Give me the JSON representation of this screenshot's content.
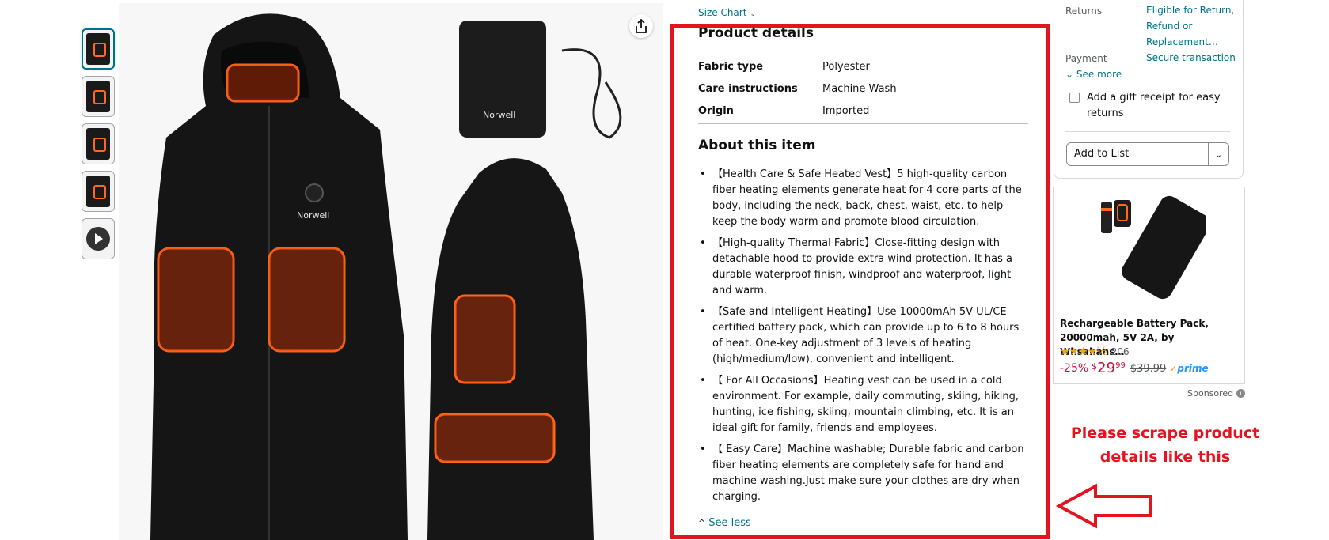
{
  "thumbnails": [
    {
      "name": "thumbnail-1",
      "active": true
    },
    {
      "name": "thumbnail-2",
      "active": false
    },
    {
      "name": "thumbnail-3",
      "active": false
    },
    {
      "name": "thumbnail-4",
      "active": false
    },
    {
      "name": "thumbnail-video",
      "active": false
    }
  ],
  "product_image": {
    "brand_on_vest": "Norwell",
    "brand_on_battery": "Norwell"
  },
  "size_chart": {
    "label": "Size Chart"
  },
  "product_details": {
    "title": "Product details",
    "rows": [
      {
        "key": "Fabric type",
        "value": "Polyester"
      },
      {
        "key": "Care instructions",
        "value": "Machine Wash"
      },
      {
        "key": "Origin",
        "value": "Imported"
      }
    ]
  },
  "about": {
    "title": "About this item",
    "bullets": [
      "【Health Care & Safe Heated Vest】5 high-quality carbon fiber heating elements generate heat for 4 core parts of the body, including the neck, back, chest, waist, etc. to help keep the body warm and promote blood circulation.",
      "【High-quality Thermal Fabric】Close-fitting design with detachable hood to provide extra wind protection. It has a durable waterproof finish, windproof and waterproof, light and warm.",
      "【Safe and Intelligent Heating】Use 10000mAh 5V UL/CE certified battery pack, which can provide up to 6 to 8 hours of heat. One-key adjustment of 3 levels of heating (high/medium/low), convenient and intelligent.",
      "【 For All Occasions】Heating vest can be used in a cold environment. For example, daily commuting, skiing, hiking, hunting, ice fishing, skiing, mountain climbing, etc. It is an ideal gift for family, friends and employees.",
      "【 Easy Care】Machine washable; Durable fabric and carbon fiber heating elements are completely safe for hand and machine washing.Just make sure your clothes are dry when charging."
    ],
    "see_less": "See less"
  },
  "buybox": {
    "returns_label": "Returns",
    "returns_value": "Eligible for Return, Refund or Replacement…",
    "payment_label": "Payment",
    "payment_value": "Secure transaction",
    "see_more": "See more",
    "gift_receipt": "Add a gift receipt for easy returns",
    "add_to_list": "Add to List"
  },
  "sponsored_ad": {
    "title": "Rechargeable Battery Pack, 20000mah, 5V 2A, by Whsahans…",
    "stars": "★★★★½",
    "rating_value": 4.5,
    "review_count": "206",
    "discount": "-25%",
    "currency": "$",
    "price_whole": "29",
    "price_fraction": "99",
    "list_price": "$39.99",
    "prime": "prime",
    "sponsored_label": "Sponsored"
  },
  "annotation": {
    "text": "Please scrape product details like this",
    "color": "#e3131f"
  },
  "colors": {
    "link": "#007185",
    "price_red": "#cc0c39",
    "highlight_red": "#e3131f",
    "star": "#f0a11f"
  }
}
